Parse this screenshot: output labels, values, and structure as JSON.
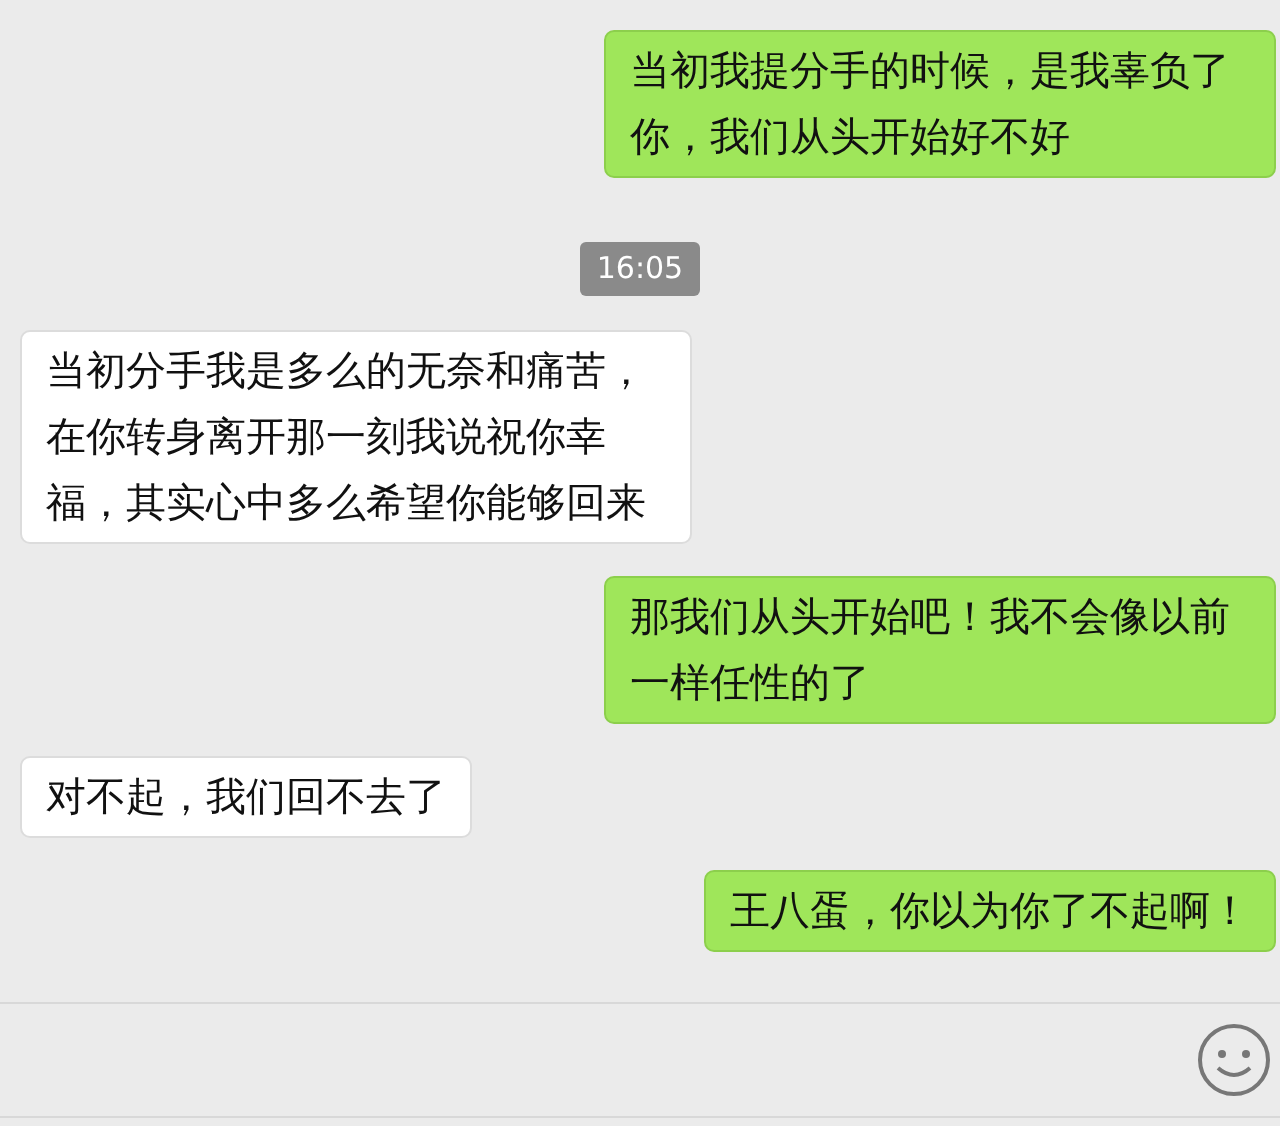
{
  "messages": [
    {
      "kind": "sent",
      "text": "当初我提分手的时候，是我辜负了你，我们从头开始好不好"
    },
    {
      "kind": "time",
      "text": "16:05"
    },
    {
      "kind": "received",
      "text": "当初分手我是多么的无奈和痛苦，在你转身离开那一刻我说祝你幸福，其实心中多么希望你能够回来"
    },
    {
      "kind": "sent",
      "text": "那我们从头开始吧！我不会像以前一样任性的了"
    },
    {
      "kind": "received",
      "text": "对不起，我们回不去了"
    },
    {
      "kind": "sent",
      "text": "王八蛋，你以为你了不起啊！"
    }
  ]
}
